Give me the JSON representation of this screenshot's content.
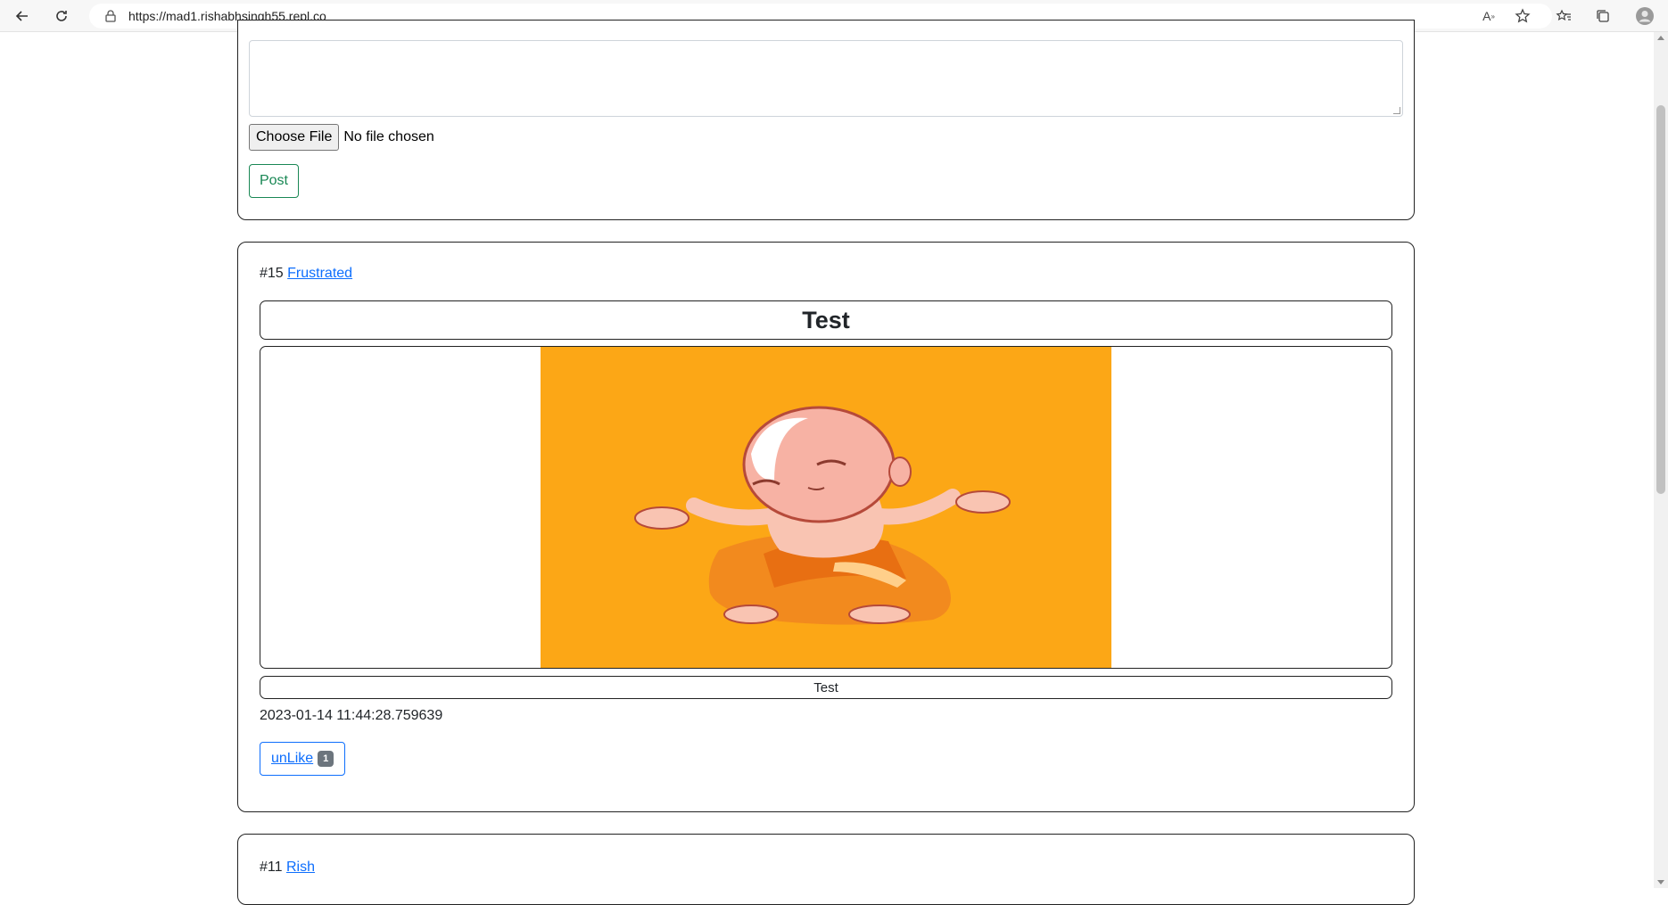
{
  "browser": {
    "url": "https://mad1.rishabhsingh55.repl.co"
  },
  "composer": {
    "choose_file_label": "Choose File",
    "file_status": "No file chosen",
    "post_label": "Post"
  },
  "posts": [
    {
      "id_label": "#15",
      "author": "Frustrated",
      "title": "Test",
      "caption": "Test",
      "timestamp": "2023-01-14 11:44:28.759639",
      "like_label": "unLike",
      "like_count": "1",
      "image_bg": "#fca716"
    },
    {
      "id_label": "#11",
      "author": "Rish"
    }
  ],
  "colors": {
    "primary": "#0d6efd",
    "success": "#198754",
    "badge": "#6c757d"
  }
}
